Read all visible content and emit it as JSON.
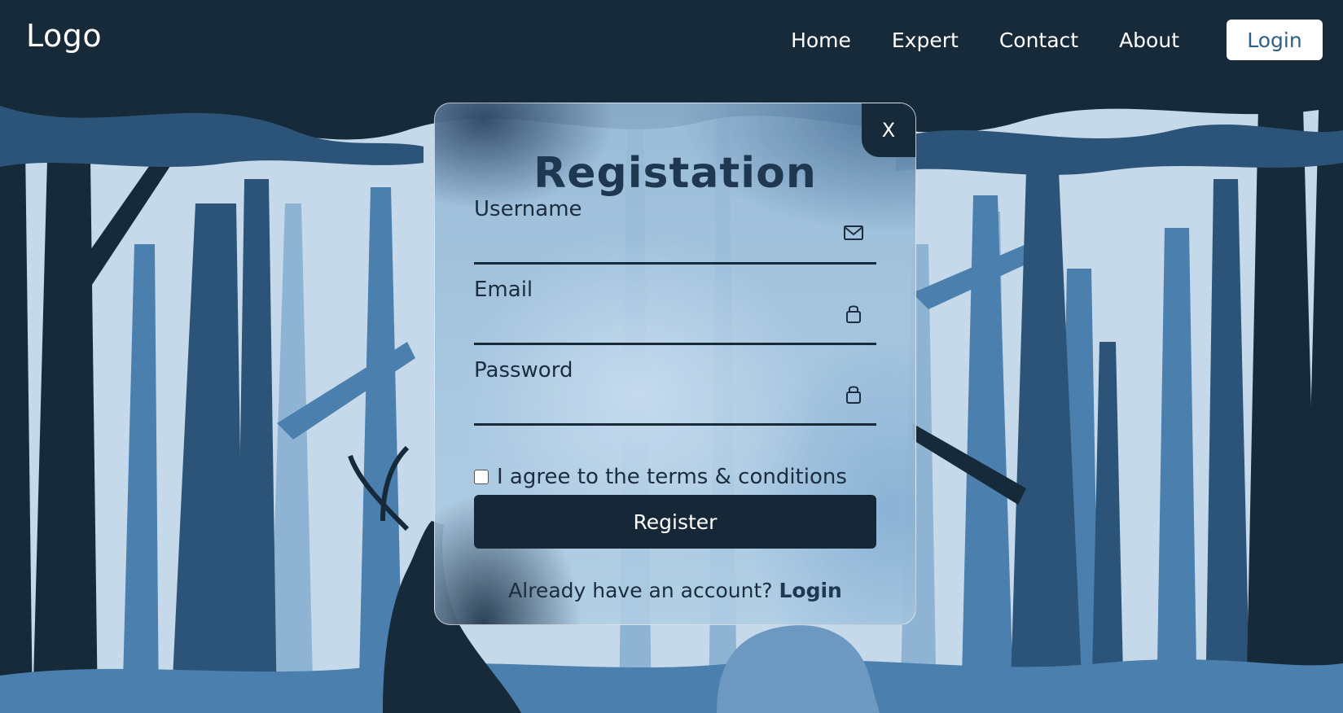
{
  "header": {
    "logo": "Logo",
    "nav": [
      "Home",
      "Expert",
      "Contact",
      "About"
    ],
    "login_button": "Login"
  },
  "modal": {
    "close_label": "X",
    "title": "Registation",
    "fields": [
      {
        "label": "Username",
        "icon": "mail-icon",
        "value": ""
      },
      {
        "label": "Email",
        "icon": "lock-icon",
        "value": ""
      },
      {
        "label": "Password",
        "icon": "lock-icon",
        "value": ""
      }
    ],
    "terms_label": "I agree to the terms & conditions",
    "terms_checked": false,
    "register_button": "Register",
    "account_prompt": "Already have an account?",
    "account_login": "Login"
  },
  "colors": {
    "dark_navy": "#172a3a",
    "sky": "#c5d9ea",
    "mid_blue": "#4a7fae",
    "deep_blue": "#2b5478",
    "accent_text": "#2f5f86"
  }
}
